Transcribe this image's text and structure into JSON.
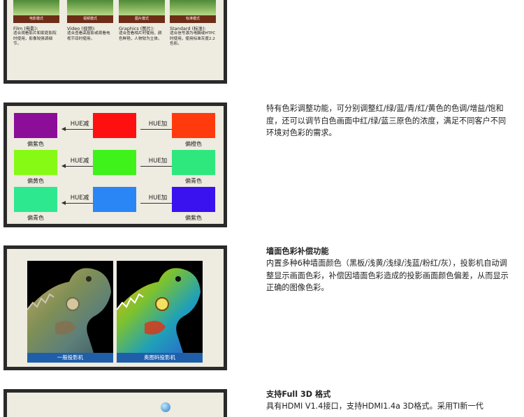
{
  "section_modes": {
    "modes": [
      {
        "bar": "电影模式",
        "title": "Film (电影):",
        "desc": "适合观看影片和家庭影院时使用，影像较强调细节。"
      },
      {
        "bar": "视频模式",
        "title": "Video (视频):",
        "desc": "适合查看高投影或观看电视节目时使用。"
      },
      {
        "bar": "图片模式",
        "title": "Graphics (图片):",
        "desc": "适合查看相片时使用，颜色鲜艳，人物较为立体。"
      },
      {
        "bar": "标准模式",
        "title": "Standard (标准):",
        "desc": "适合信号源为电脑或HTPC时使用，使用标准灰度2.2色彩。"
      }
    ]
  },
  "section_color": {
    "description": "特有色彩调整功能，可分别调整红/绿/蓝/青/红/黄色的色调/增益/饱和度，还可以调节白色画面中红/绿/蓝三原色的浓度，满足不同客户不同环境对色彩的需求。",
    "rows": [
      {
        "left_color": "#8c0d98",
        "left_label": "偏紫色",
        "center_color": "#ff1010",
        "right_color": "#ff3a0c",
        "right_label": "偏橙色",
        "hue_minus": "HUE减",
        "hue_plus": "HUE加"
      },
      {
        "left_color": "#86fa14",
        "left_label": "偏黄色",
        "center_color": "#3ef21a",
        "right_color": "#2ee87e",
        "right_label": "偏青色",
        "hue_minus": "HUE减",
        "hue_plus": "HUE加"
      },
      {
        "left_color": "#2ee890",
        "left_label": "偏青色",
        "center_color": "#2b86f5",
        "right_color": "#3a12f0",
        "right_label": "偏紫色",
        "hue_minus": "HUE减",
        "hue_plus": "HUE加"
      }
    ]
  },
  "section_wall": {
    "heading": "墙面色彩补偿功能",
    "description": "内置多种6种墙面颜色（黑板/浅黄/浅绿/浅蓝/粉红/灰），投影机自动调整显示画面色彩，补偿因墙面色彩造成的投影画面颜色偏差，从而显示正确的图像色彩。",
    "captions": [
      "一般投影机",
      "奥图码投影机"
    ]
  },
  "section_3d": {
    "heading": "支持Full 3D 格式",
    "description": "具有HDMI V1.4接口，支持HDMI1.4a 3D格式。采用TI新一代"
  }
}
